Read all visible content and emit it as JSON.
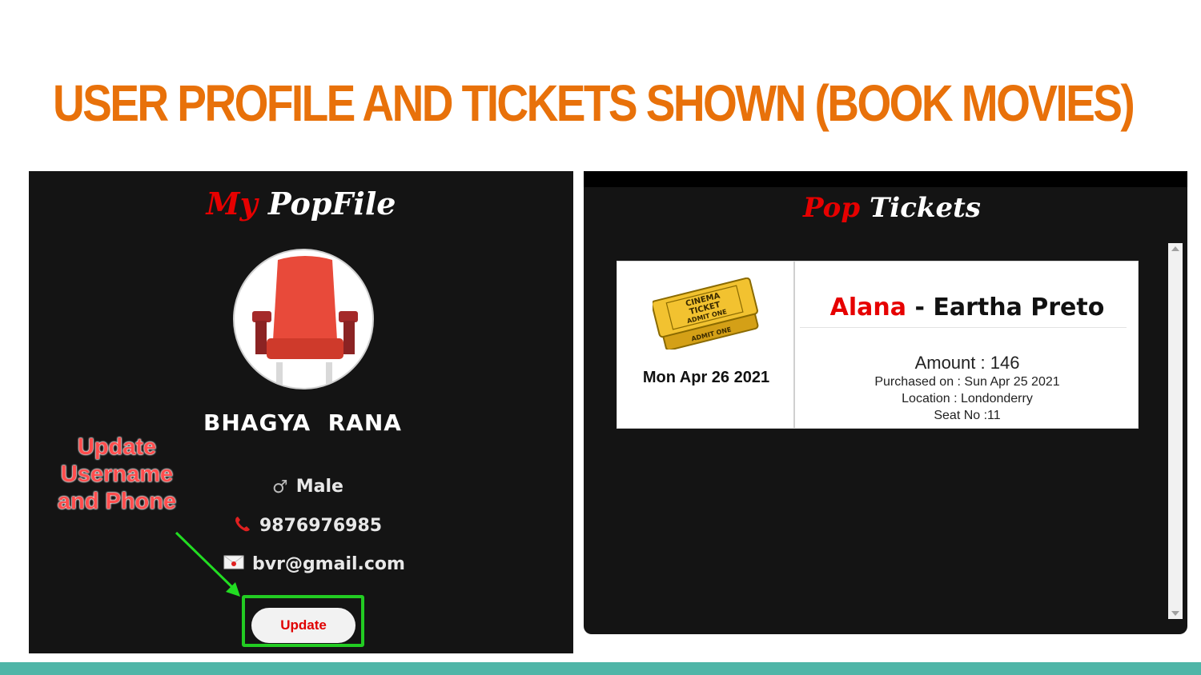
{
  "slide": {
    "title": "USER PROFILE AND TICKETS SHOWN (BOOK MOVIES)",
    "accent_color": "#e8710a",
    "bottom_bar_color": "#4fb5a7"
  },
  "profile": {
    "heading_accent": "My",
    "heading_rest": "PopFile",
    "avatar_icon": "cinema-seat-icon",
    "username": "BHAGYA  RANA",
    "gender_icon": "male-symbol-icon",
    "gender_glyph": "♂",
    "gender": "Male",
    "phone_icon": "phone-icon",
    "phone": "9876976985",
    "email_icon": "envelope-icon",
    "email": "bvr@gmail.com",
    "update_button_label": "Update"
  },
  "annotation": {
    "callout_lines": [
      "Update",
      "Username",
      "and Phone"
    ],
    "highlight_color": "#22cc22"
  },
  "tickets": {
    "heading_accent": "Pop",
    "heading_rest": "Tickets",
    "items": [
      {
        "image_icon": "cinema-ticket-icon",
        "image_text": [
          "CINEMA",
          "TICKET",
          "ADMIT ONE"
        ],
        "show_date": "Mon Apr 26 2021",
        "movie": "Alana",
        "separator": "-",
        "theatre": "Eartha Preto",
        "amount": "Amount : 146",
        "purchased": "Purchased on : Sun Apr 25 2021",
        "location": "Location : Londonderry",
        "seat": "Seat No :11"
      }
    ]
  }
}
